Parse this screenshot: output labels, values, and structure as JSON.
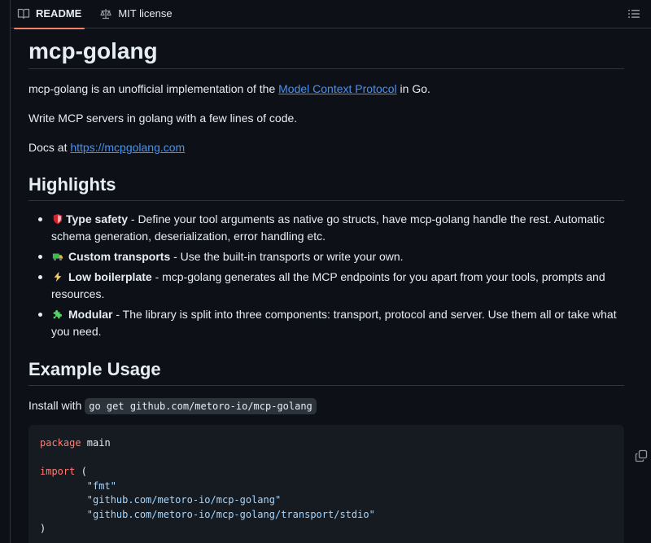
{
  "tabs": [
    {
      "label": "README",
      "icon": "book-icon",
      "active": true
    },
    {
      "label": "MIT license",
      "icon": "law-icon",
      "active": false
    }
  ],
  "title": "mcp-golang",
  "intro": {
    "before": "mcp-golang is an unofficial implementation of the ",
    "link": "Model Context Protocol",
    "after": " in Go."
  },
  "write_line": "Write MCP servers in golang with a few lines of code.",
  "docs": {
    "before": "Docs at ",
    "link": "https://mcpgolang.com"
  },
  "highlights_heading": "Highlights",
  "highlights": [
    {
      "icon": "shield-icon",
      "title": "Type safety",
      "text": " - Define your tool arguments as native go structs, have mcp-golang handle the rest. Automatic schema generation, deserialization, error handling etc."
    },
    {
      "icon": "truck-icon",
      "title": "Custom transports",
      "text": " - Use the built-in transports or write your own."
    },
    {
      "icon": "lightning-icon",
      "title": "Low boilerplate",
      "text": " - mcp-golang generates all the MCP endpoints for you apart from your tools, prompts and resources."
    },
    {
      "icon": "puzzle-icon",
      "title": "Modular",
      "text": " - The library is split into three components: transport, protocol and server. Use them all or take what you need."
    }
  ],
  "example_heading": "Example Usage",
  "install": {
    "before": "Install with ",
    "code": "go get github.com/metoro-io/mcp-golang"
  },
  "code": {
    "line1_kw": "package",
    "line1_rest": " main",
    "line3_kw": "import",
    "line3_rest": " (",
    "imports": [
      "\"fmt\"",
      "\"github.com/metoro-io/mcp-golang\"",
      "\"github.com/metoro-io/mcp-golang/transport/stdio\""
    ],
    "close": ")"
  }
}
